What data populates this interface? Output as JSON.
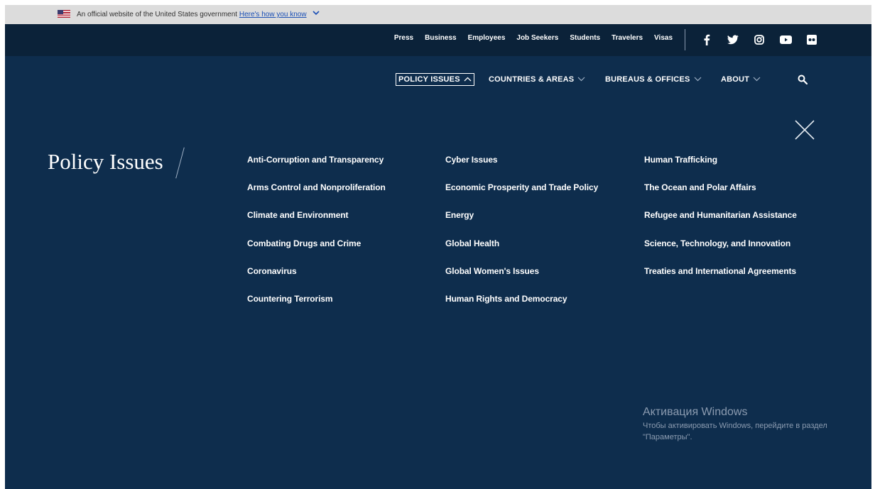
{
  "gov_banner": {
    "text": "An official website of the United States government",
    "link": "Here's how you know"
  },
  "utility_nav": {
    "links": [
      "Press",
      "Business",
      "Employees",
      "Job Seekers",
      "Students",
      "Travelers",
      "Visas"
    ],
    "social": [
      "facebook-icon",
      "twitter-icon",
      "instagram-icon",
      "youtube-icon",
      "flickr-icon"
    ]
  },
  "main_nav": {
    "items": [
      {
        "label": "POLICY ISSUES",
        "expanded": true
      },
      {
        "label": "COUNTRIES & AREAS",
        "expanded": false
      },
      {
        "label": "BUREAUS & OFFICES",
        "expanded": false
      },
      {
        "label": "ABOUT",
        "expanded": false
      }
    ]
  },
  "panel": {
    "title": "Policy Issues",
    "columns": [
      [
        "Anti-Corruption and Transparency",
        "Arms Control and Nonproliferation",
        "Climate and Environment",
        "Combating Drugs and Crime",
        "Coronavirus",
        "Countering Terrorism"
      ],
      [
        "Cyber Issues",
        "Economic Prosperity and Trade Policy",
        "Energy",
        "Global Health",
        "Global Women's Issues",
        "Human Rights and Democracy"
      ],
      [
        "Human Trafficking",
        "The Ocean and Polar Affairs",
        "Refugee and Humanitarian Assistance",
        "Science, Technology, and Innovation",
        "Treaties and International Agreements"
      ]
    ]
  },
  "watermark": {
    "title": "Активация Windows",
    "subtitle": "Чтобы активировать Windows, перейдите в раздел \"Параметры\"."
  },
  "colors": {
    "banner_bg": "#dcdcdc",
    "utility_bg": "#0b2239",
    "main_bg": "#0e2d4d",
    "link_blue": "#1a4fb5"
  }
}
